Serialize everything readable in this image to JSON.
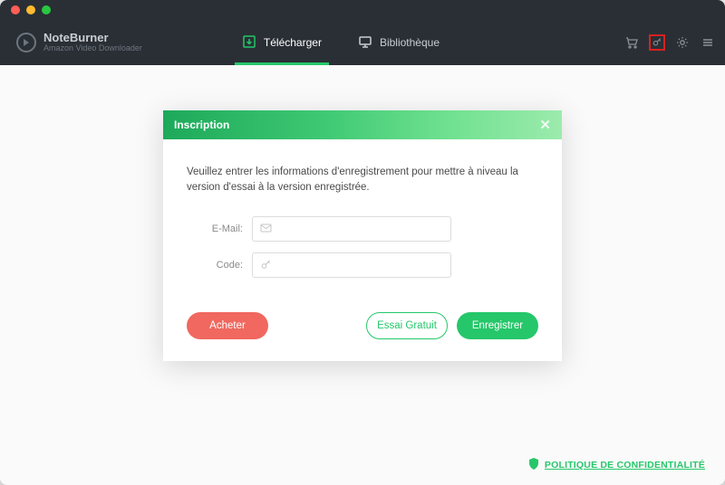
{
  "brand": {
    "name": "NoteBurner",
    "subtitle": "Amazon Video Downloader"
  },
  "tabs": {
    "download": "Télécharger",
    "library": "Bibliothèque"
  },
  "modal": {
    "title": "Inscription",
    "message": "Veuillez entrer les informations d'enregistrement pour mettre à niveau la version d'essai à la version enregistrée.",
    "email_label": "E-Mail:",
    "code_label": "Code:",
    "buy": "Acheter",
    "trial": "Essai Gratuit",
    "register": "Enregistrer"
  },
  "footer": {
    "privacy": "POLITIQUE DE CONFIDENTIALITÉ"
  }
}
